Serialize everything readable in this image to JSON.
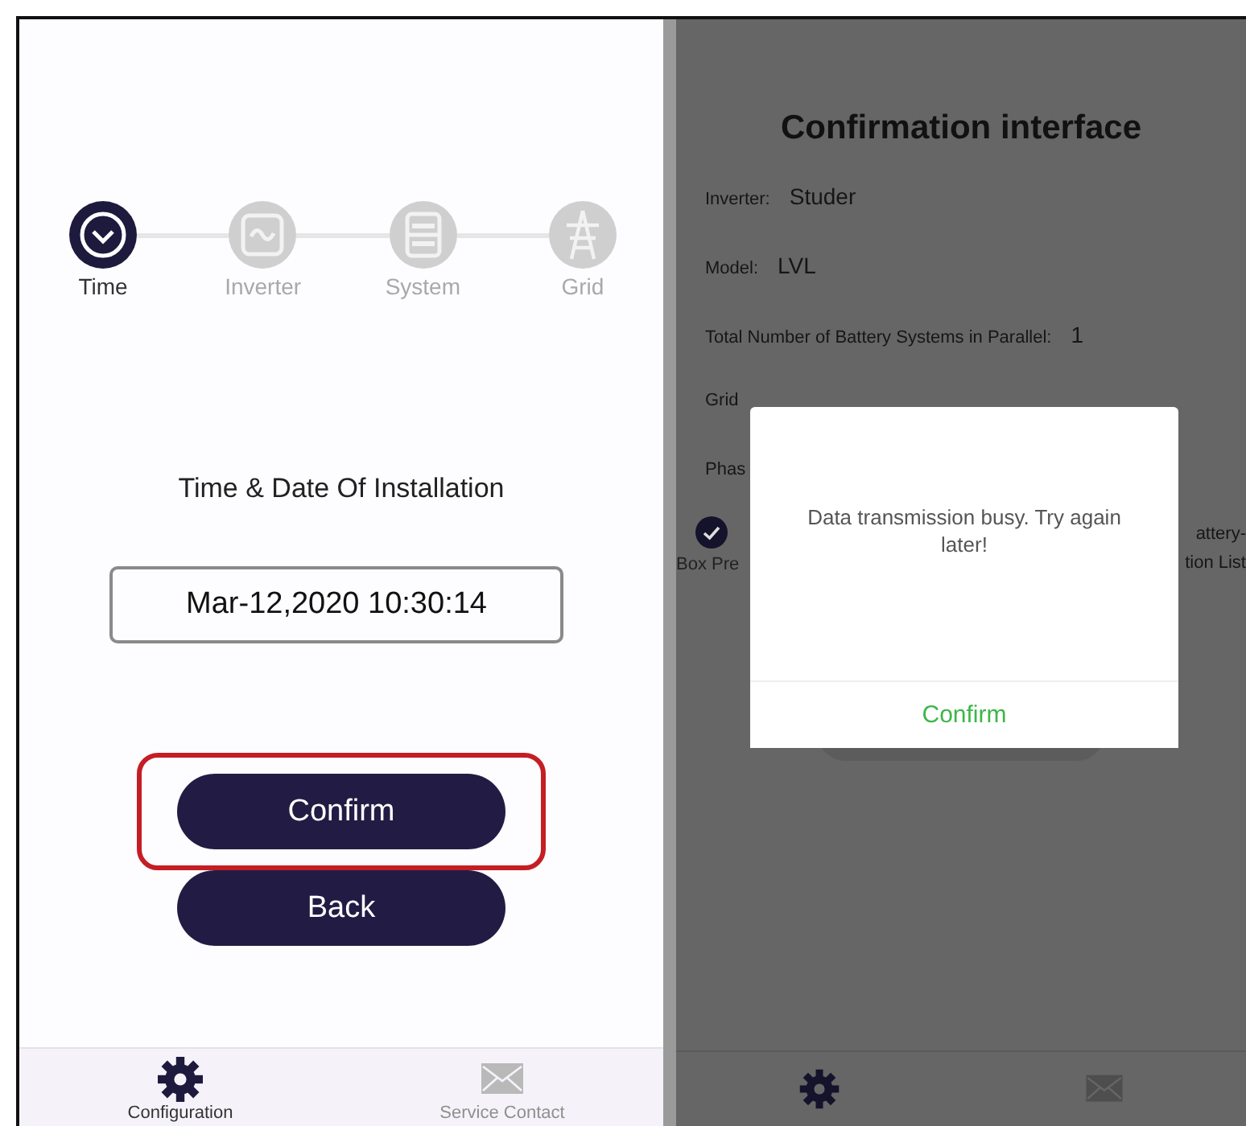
{
  "setup": {
    "steps": [
      {
        "label": "Time",
        "kind": "clock",
        "selected": true
      },
      {
        "label": "Inverter",
        "kind": "wave",
        "selected": false
      },
      {
        "label": "System",
        "kind": "bars",
        "selected": false
      },
      {
        "label": "Grid",
        "kind": "pylon",
        "selected": false
      }
    ],
    "heading": "Time & Date Of Installation",
    "datetime": "Mar-12,2020 10:30:14",
    "buttons": [
      {
        "label": "Confirm",
        "highlighted": true
      },
      {
        "label": "Back",
        "highlighted": false
      }
    ],
    "tabs": [
      {
        "label": "Configuration",
        "kind": "gear",
        "selected": true
      },
      {
        "label": "Service Contact",
        "kind": "mail",
        "selected": false
      }
    ]
  },
  "confirmation": {
    "title": "Confirmation interface",
    "fields": [
      {
        "label": "Inverter:",
        "value": "Studer"
      },
      {
        "label": "Model:",
        "value": "LVL"
      },
      {
        "label": "Total Number of Battery Systems in Parallel:",
        "value": "1"
      },
      {
        "label": "Grid"
      },
      {
        "label": "Phas"
      }
    ],
    "agreement": {
      "checked": true,
      "left_text": "Box Pre",
      "right_lines": [
        "attery-",
        "tion List"
      ]
    },
    "tabs": [
      {
        "kind": "gear",
        "selected": true
      },
      {
        "kind": "mail",
        "selected": false
      }
    ]
  },
  "dialog": {
    "message": "Data transmission busy. Try again later!",
    "button": "Confirm"
  }
}
